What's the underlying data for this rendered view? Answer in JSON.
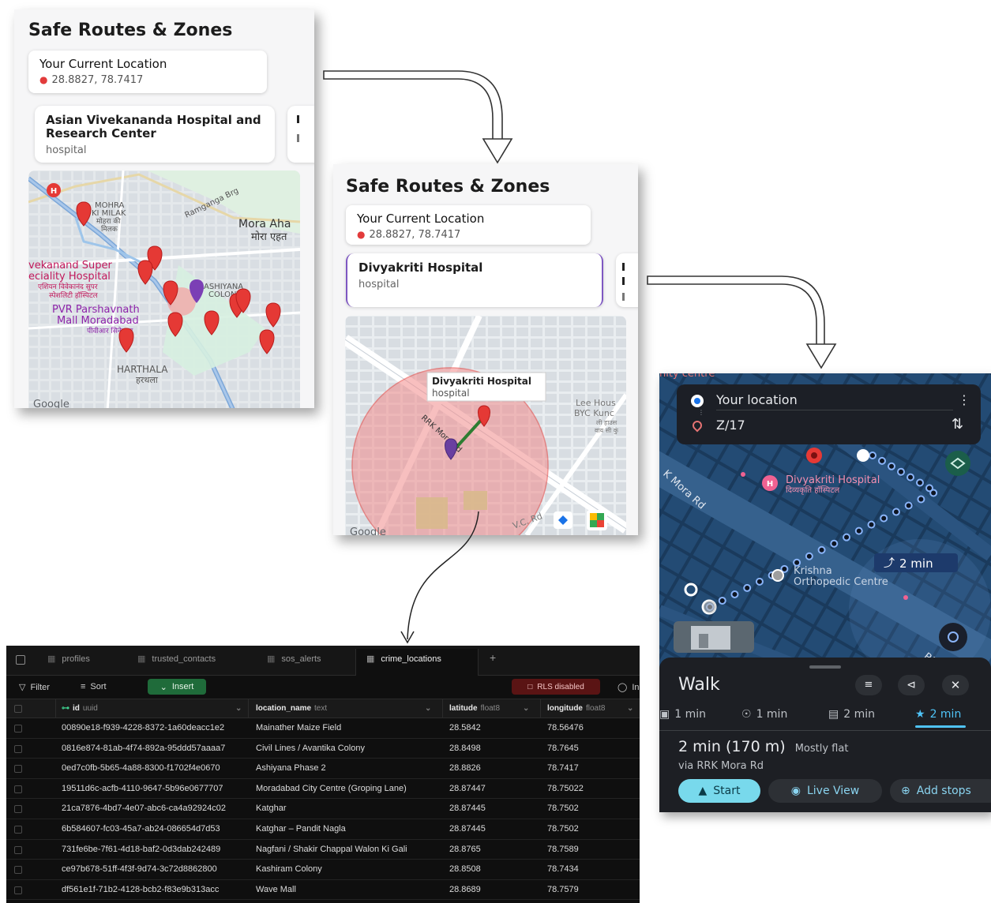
{
  "panel1": {
    "title": "Safe Routes & Zones",
    "current_location_label": "Your Current Location",
    "current_location_coords": "28.8827, 78.7417",
    "hospital_name": "Asian Vivekananda Hospital and Research Center",
    "hospital_type": "hospital",
    "map_labels": {
      "mohra": "MOHRA",
      "ki_milak": "KI MILAK",
      "mohra_hi": "मोहरा की",
      "milak_hi": "मिलक",
      "ramganga": "Ramganga Brg",
      "mora_aha": "Mora Aha",
      "mora_aha_hi": "मोरा एहत",
      "vivekanand_1": "vekanand Super",
      "vivekanand_2": "eciality Hospital",
      "vivekanand_hi1": "एशियन विवेकानंद सुपर",
      "vivekanand_hi2": "स्पेशलिटी हॉस्पिटल",
      "pvr_1": "PVR Parshavnath",
      "pvr_2": "Mall Moradabad",
      "pvr_hi": "पीवीआर सिनेमाज",
      "ashiyana_1": "ASHIYANA",
      "ashiyana_2": "COLONY",
      "harthala": "HARTHALA",
      "harthala_hi": "हरथला",
      "google": "Google"
    }
  },
  "panel2": {
    "title": "Safe Routes & Zones",
    "current_location_label": "Your Current Location",
    "current_location_coords": "28.8827, 78.7417",
    "hospital_name": "Divyakriti Hospital",
    "hospital_type": "hospital",
    "tooltip_name": "Divyakriti Hospital",
    "tooltip_type": "hospital",
    "map_labels": {
      "rrk": "RRK Mora Rd",
      "lee_1": "Lee Hous",
      "lee_2": "BYC Kunc",
      "lee_hi1": "ली हाउस",
      "lee_hi2": "वाय सी कुं",
      "vc_rd": "V.C. Rd",
      "google": "Google"
    }
  },
  "nav": {
    "top_strip": "nity centre",
    "from": "Your location",
    "to": "Z/17",
    "hospital": "Divyakriti Hospital",
    "hospital_hi": "दिव्यकृति हॉस्पिटल",
    "road": "K Mora Rd",
    "krishna_1": "Krishna",
    "krishna_2": "Orthopedic Centre",
    "walk_badge": "2 min",
    "rrk_corner": "RRK",
    "mode_title": "Walk",
    "modes": [
      {
        "icon": "car-icon",
        "label": "1 min"
      },
      {
        "icon": "motorbike-icon",
        "label": "1 min"
      },
      {
        "icon": "transit-icon",
        "label": "2 min"
      },
      {
        "icon": "walk-icon",
        "label": "2 min"
      }
    ],
    "summary_time": "2 min (170 m)",
    "summary_note": "Mostly flat",
    "via": "via RRK Mora Rd",
    "start_label": "Start",
    "live_view_label": "Live View",
    "add_stops_label": "Add stops",
    "accent_color": "#4fc3f7"
  },
  "db": {
    "tabs": [
      "profiles",
      "trusted_contacts",
      "sos_alerts",
      "crime_locations"
    ],
    "active_tab": "crime_locations",
    "add_tab": "+",
    "filter_label": "Filter",
    "sort_label": "Sort",
    "insert_label": "Insert",
    "rls_label": "RLS disabled",
    "index_label": "In",
    "columns": [
      {
        "name": "id",
        "type": "uuid"
      },
      {
        "name": "location_name",
        "type": "text"
      },
      {
        "name": "latitude",
        "type": "float8"
      },
      {
        "name": "longitude",
        "type": "float8"
      }
    ],
    "rows": [
      {
        "id": "00890e18-f939-4228-8372-1a60deacc1e2",
        "location_name": "Mainather Maize Field",
        "latitude": "28.5842",
        "longitude": "78.56476"
      },
      {
        "id": "0816e874-81ab-4f74-892a-95ddd57aaaa7",
        "location_name": "Civil Lines / Avantika Colony",
        "latitude": "28.8498",
        "longitude": "78.7645"
      },
      {
        "id": "0ed7c0fb-5b65-4a88-8300-f1702f4e0670",
        "location_name": "Ashiyana Phase 2",
        "latitude": "28.8826",
        "longitude": "78.7417"
      },
      {
        "id": "19511d6c-acfb-4110-9647-5b96e0677707",
        "location_name": "Moradabad City Centre (Groping Lane)",
        "latitude": "28.87447",
        "longitude": "78.75022"
      },
      {
        "id": "21ca7876-4bd7-4e07-abc6-ca4a92924c02",
        "location_name": "Katghar",
        "latitude": "28.87445",
        "longitude": "78.7502"
      },
      {
        "id": "6b584607-fc03-45a7-ab24-086654d7d53",
        "location_name": "Katghar – Pandit Nagla",
        "latitude": "28.87445",
        "longitude": "78.7502"
      },
      {
        "id": "731fe6be-7f61-4d18-baf2-0d3dab242489",
        "location_name": "Nagfani / Shakir Chappal Walon Ki Gali",
        "latitude": "28.8765",
        "longitude": "78.7589"
      },
      {
        "id": "ce97b678-51ff-4f3f-9d74-3c72d8862800",
        "location_name": "Kashiram Colony",
        "latitude": "28.8508",
        "longitude": "78.7434"
      },
      {
        "id": "df561e1f-71b2-4128-bcb2-f83e9b313acc",
        "location_name": "Wave Mall",
        "latitude": "28.8689",
        "longitude": "78.7579"
      }
    ]
  }
}
